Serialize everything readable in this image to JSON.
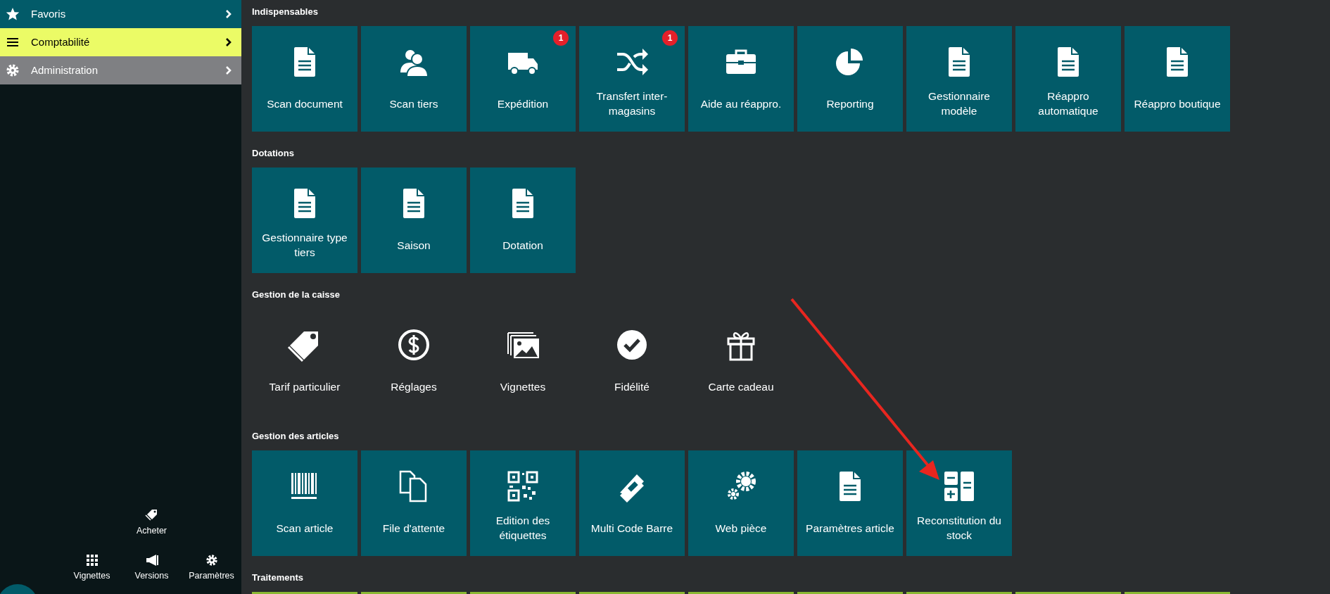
{
  "sidebar": {
    "menu": [
      {
        "label": "Favoris",
        "color": "#025b69",
        "selected": false
      },
      {
        "label": "Comptabilité",
        "color": "#ebfb66",
        "selected": true
      },
      {
        "label": "Administration",
        "color": "#7f8083",
        "selected": false
      }
    ],
    "shortcuts": [
      {
        "label": "Acheter"
      }
    ],
    "footer": [
      {
        "label": "Vignettes"
      },
      {
        "label": "Versions"
      },
      {
        "label": "Paramètres"
      }
    ]
  },
  "sections": [
    {
      "title": "Indispensables",
      "kind": "filled",
      "tiles": [
        {
          "label": "Scan document"
        },
        {
          "label": "Scan tiers"
        },
        {
          "label": "Expédition",
          "badge": "1"
        },
        {
          "label": "Transfert inter-magasins",
          "badge": "1"
        },
        {
          "label": "Aide au réappro."
        },
        {
          "label": "Reporting"
        },
        {
          "label": "Gestionnaire modèle"
        },
        {
          "label": "Réappro automatique"
        },
        {
          "label": "Réappro boutique"
        }
      ]
    },
    {
      "title": "Dotations",
      "kind": "filled",
      "tiles": [
        {
          "label": "Gestionnaire type tiers"
        },
        {
          "label": "Saison"
        },
        {
          "label": "Dotation"
        }
      ]
    },
    {
      "title": "Gestion de la caisse",
      "kind": "plain",
      "tiles": [
        {
          "label": "Tarif particulier"
        },
        {
          "label": "Réglages"
        },
        {
          "label": "Vignettes"
        },
        {
          "label": "Fidélité"
        },
        {
          "label": "Carte cadeau"
        }
      ]
    },
    {
      "title": "Gestion des articles",
      "kind": "filled",
      "tiles": [
        {
          "label": "Scan article"
        },
        {
          "label": "File d'attente"
        },
        {
          "label": "Edition des étiquettes"
        },
        {
          "label": "Multi Code Barre"
        },
        {
          "label": "Web pièce"
        },
        {
          "label": "Paramètres article"
        },
        {
          "label": "Reconstitution du stock"
        }
      ]
    },
    {
      "title": "Traitements",
      "kind": "green"
    }
  ]
}
